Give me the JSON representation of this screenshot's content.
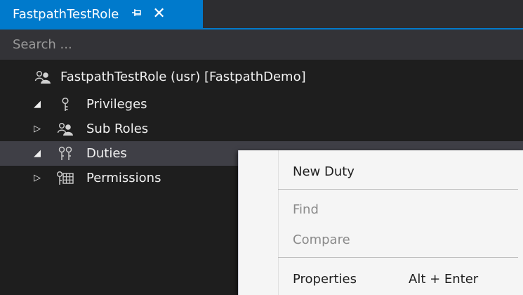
{
  "tab": {
    "title": "FastpathTestRole",
    "pin_icon": "pin-icon",
    "close_glyph": "✕"
  },
  "search": {
    "placeholder": "Search ..."
  },
  "tree": {
    "root": {
      "label": "FastpathTestRole (usr) [FastpathDemo]",
      "icon": "role-icon"
    },
    "nodes": [
      {
        "label": "Privileges",
        "icon": "privilege-icon",
        "expanded": true
      },
      {
        "label": "Sub Roles",
        "icon": "role-icon",
        "expanded": false
      },
      {
        "label": "Duties",
        "icon": "duty-icon",
        "expanded": true,
        "selected": true
      },
      {
        "label": "Permissions",
        "icon": "permission-icon",
        "expanded": false
      }
    ]
  },
  "context_menu": {
    "items": [
      {
        "label": "New Duty",
        "enabled": true
      },
      {
        "label": "Find",
        "enabled": false
      },
      {
        "label": "Compare",
        "enabled": false
      },
      {
        "label": "Properties",
        "enabled": true,
        "shortcut": "Alt + Enter"
      }
    ]
  },
  "colors": {
    "accent": "#007acc",
    "background": "#1e1e1e",
    "search_bg": "#333337",
    "selected_row": "#3f3f46",
    "menu_bg": "#f5f5f5"
  }
}
